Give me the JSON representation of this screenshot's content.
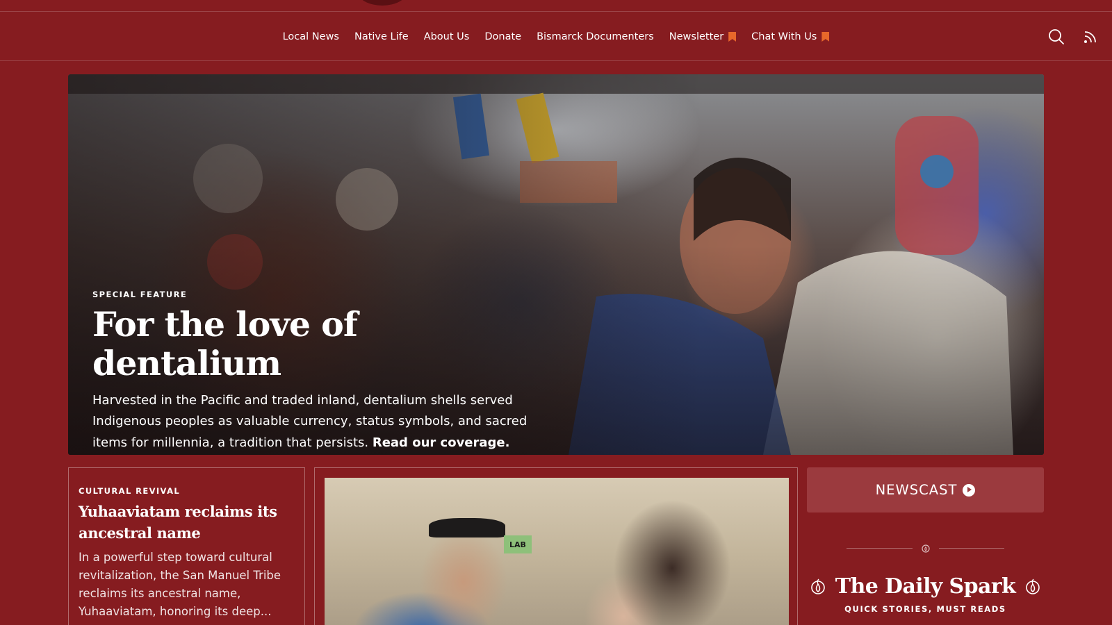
{
  "nav": {
    "items": [
      {
        "label": "Local News",
        "flag": false
      },
      {
        "label": "Native Life",
        "flag": false
      },
      {
        "label": "About Us",
        "flag": false
      },
      {
        "label": "Donate",
        "flag": false
      },
      {
        "label": "Bismarck Documenters",
        "flag": false
      },
      {
        "label": "Newsletter",
        "flag": true
      },
      {
        "label": "Chat With Us",
        "flag": true
      }
    ],
    "icons": [
      "search-icon",
      "rss-icon"
    ]
  },
  "hero": {
    "kicker": "SPECIAL FEATURE",
    "title": "For the love of dentalium",
    "dek": "Harvested in the Pacific and traded inland, dentalium shells served Indigenous peoples as valuable currency, status symbols, and sacred items for millennia, a tradition that persists.",
    "dek_link": "Read our coverage."
  },
  "card_left": {
    "kicker": "CULTURAL REVIVAL",
    "title": "Yuhaaviatam reclaims its ancestral name",
    "dek": "In a powerful step toward cultural revitalization, the San Manuel Tribe reclaims its ancestral name, Yuhaaviatam, honoring its deep..."
  },
  "card_mid": {
    "photo_sign": "LAB"
  },
  "newscast": {
    "label": "NEWSCAST",
    "icon": "play-circle-icon"
  },
  "daily_spark": {
    "title": "The Daily Spark",
    "subtitle": "QUICK STORIES, MUST READS",
    "icon": "flame-icon"
  },
  "colors": {
    "background": "#861c20",
    "accent_flag": "#e8672a",
    "newscast_bg": "#9b3a3e"
  }
}
